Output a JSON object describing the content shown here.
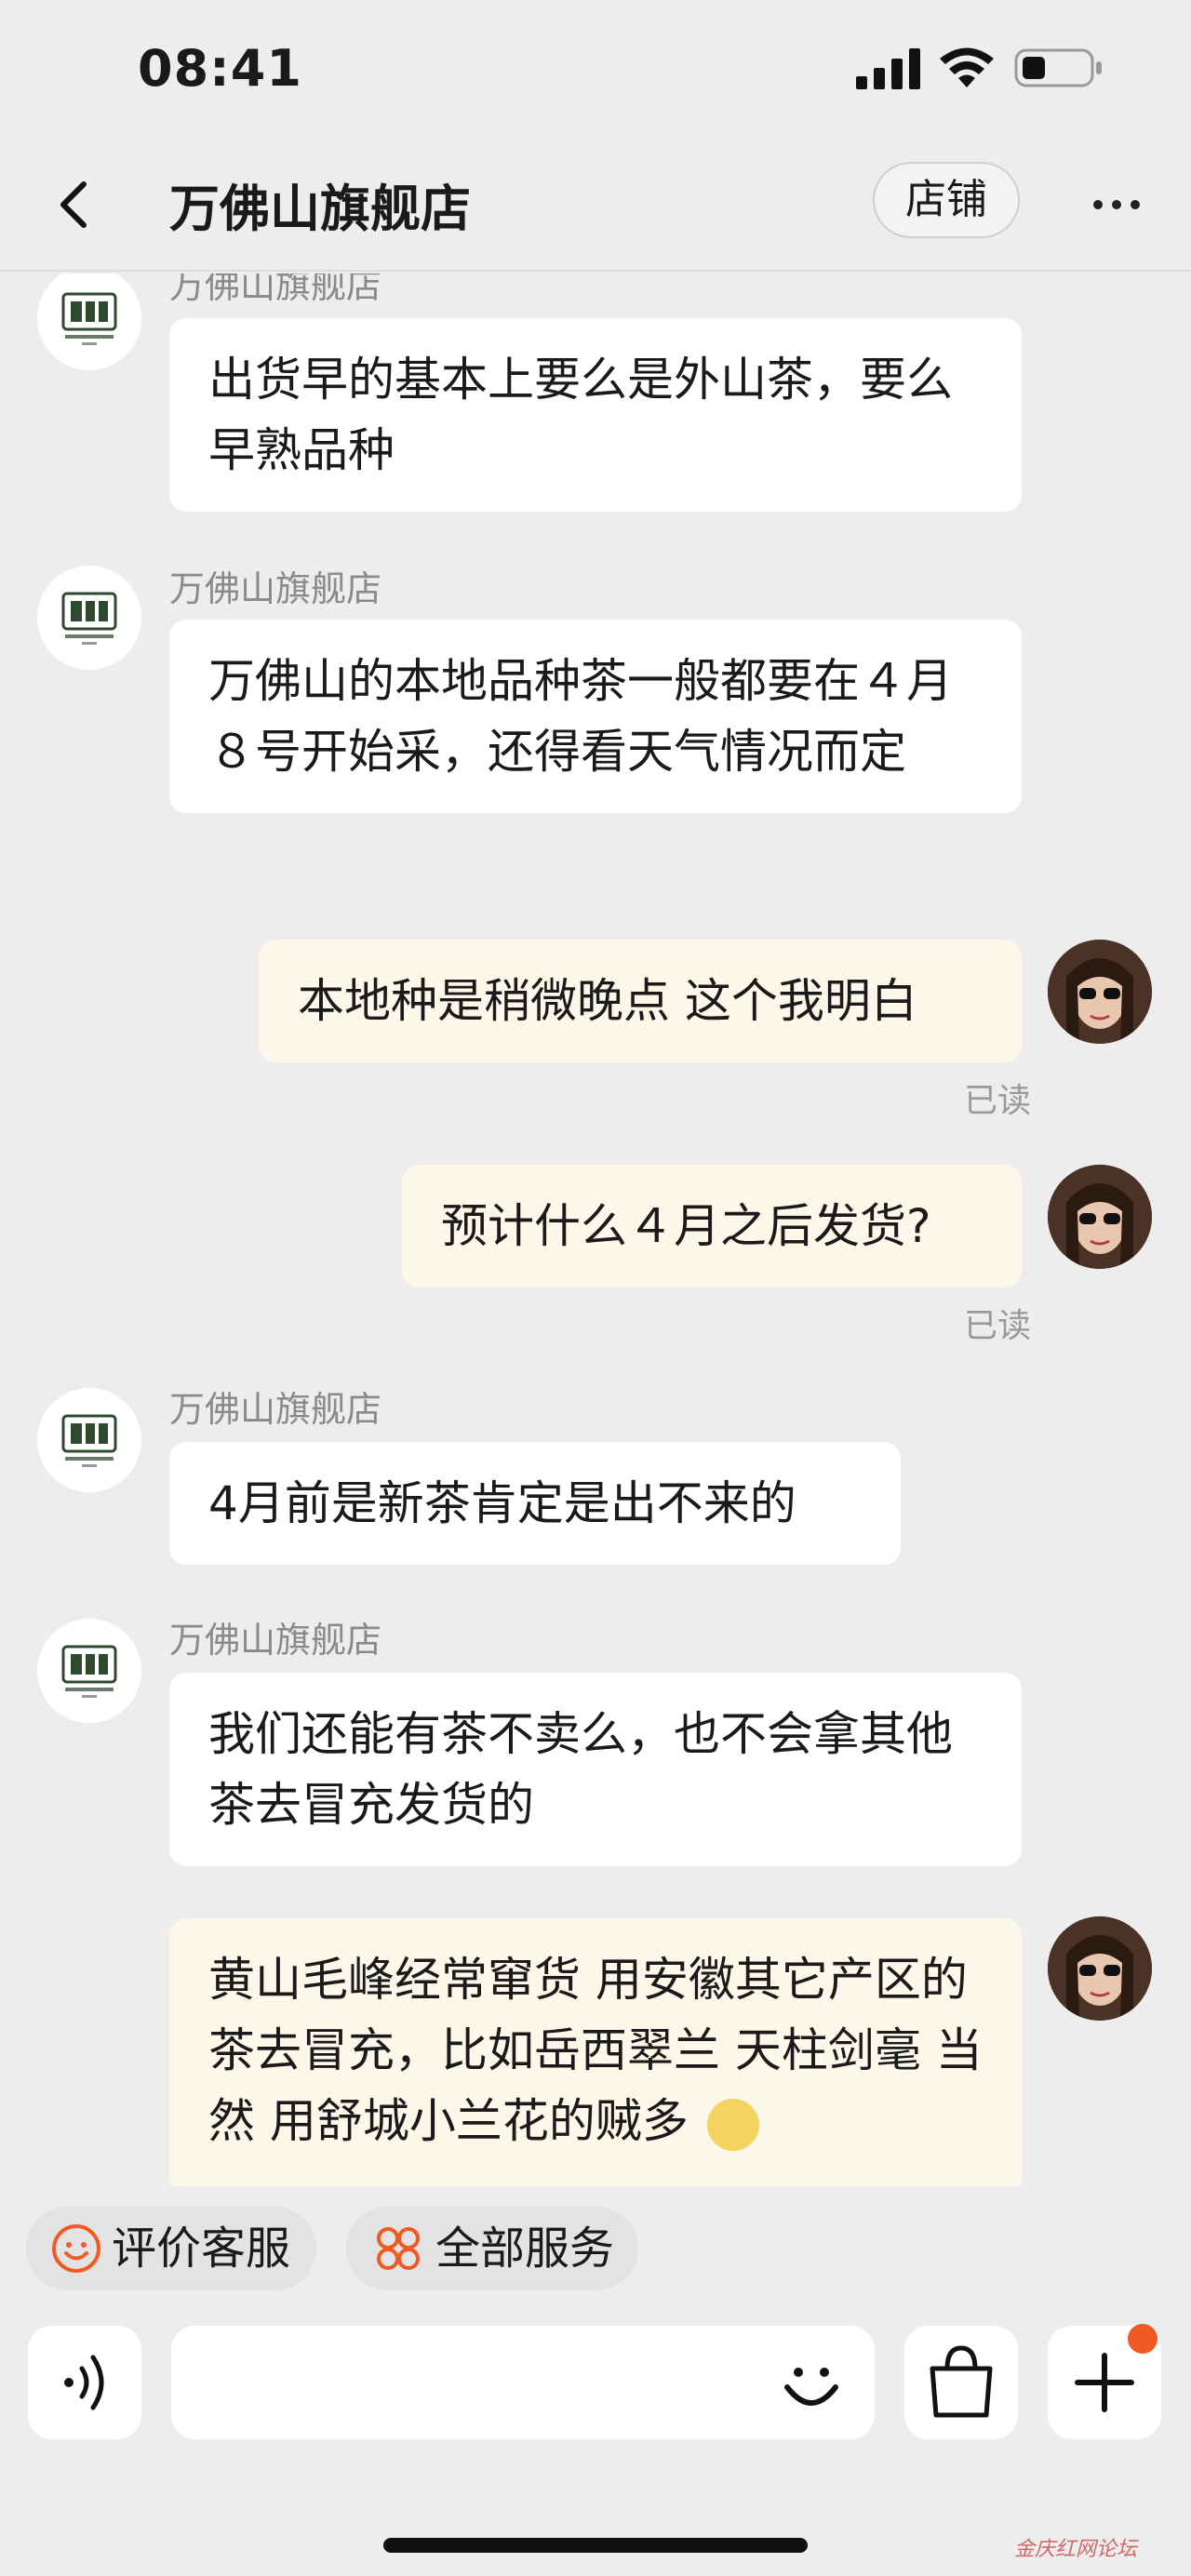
{
  "status_bar": {
    "time": "08:41"
  },
  "nav": {
    "title": "万佛山旗舰店",
    "shop_button": "店铺"
  },
  "messages": [
    {
      "sender": "万佛山旗舰店",
      "text": "出货早的基本上要么是外山茶，要么早熟品种"
    },
    {
      "sender": "万佛山旗舰店",
      "text": "万佛山的本地品种茶一般都要在４月８号开始采，还得看天气情况而定"
    },
    {
      "text": "本地种是稍微晚点 这个我明白",
      "status": "已读"
    },
    {
      "text": "预计什么４月之后发货?",
      "status": "已读"
    },
    {
      "sender": "万佛山旗舰店",
      "text": "4月前是新茶肯定是出不来的"
    },
    {
      "sender": "万佛山旗舰店",
      "text": "我们还能有茶不卖么，也不会拿其他茶去冒充发货的"
    },
    {
      "text": "黄山毛峰经常窜货 用安徽其它产区的茶去冒充，比如岳西翠兰 天柱剑毫 当然 用舒城小兰花的贼多"
    }
  ],
  "quick_services": [
    {
      "label": "评价客服",
      "icon": "smiley-icon"
    },
    {
      "label": "全部服务",
      "icon": "grid-flower-icon"
    }
  ],
  "input": {
    "placeholder": ""
  },
  "colors": {
    "accent": "#f25a23",
    "bubble_out": "#fbf8ea",
    "background": "#ededed"
  },
  "watermark": "金庆红网论坛"
}
